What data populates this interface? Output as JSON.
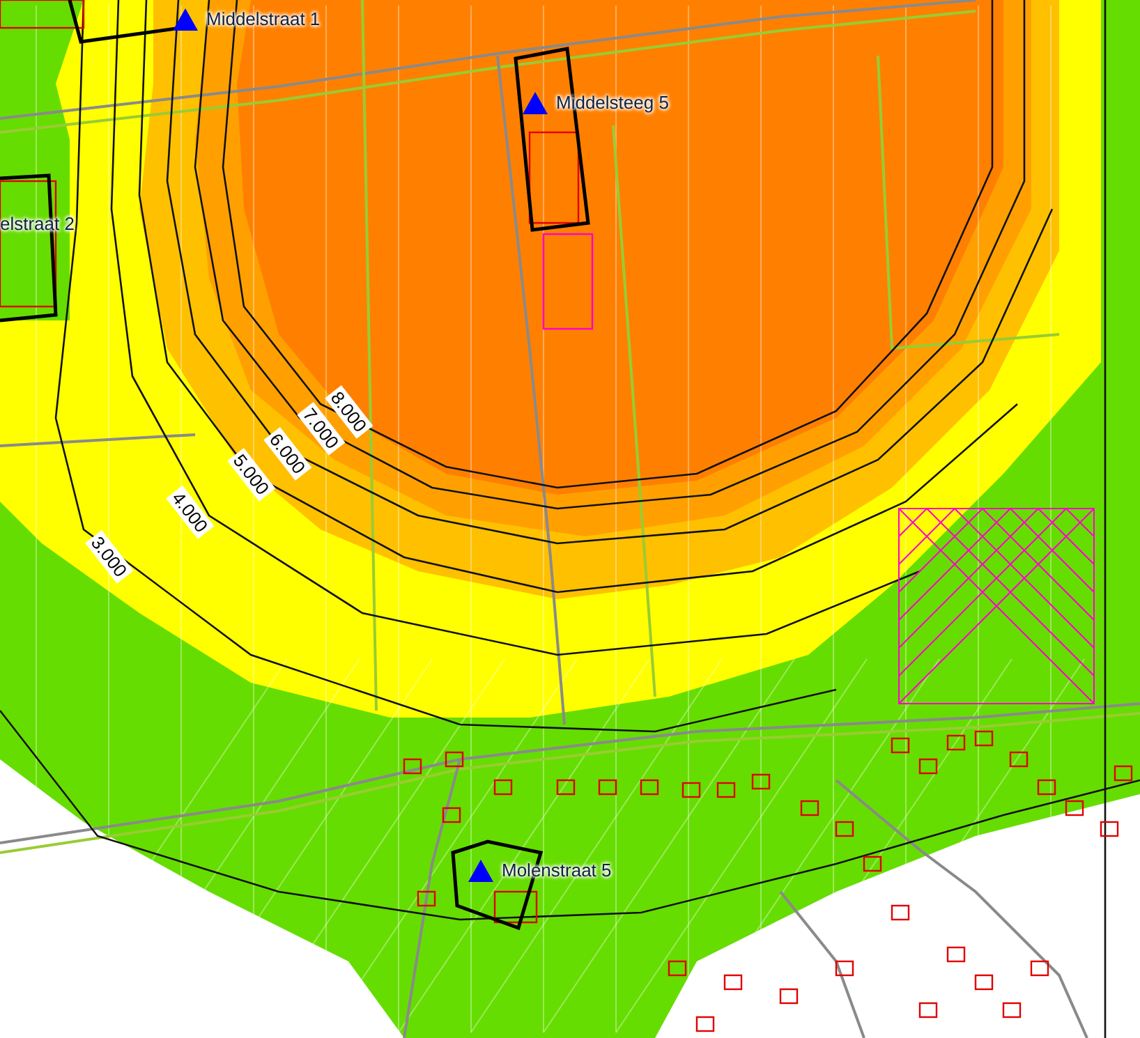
{
  "locations": [
    {
      "name": "Middelstraat 1",
      "marker": true
    },
    {
      "name": "Middelsteeg 5",
      "marker": true
    },
    {
      "name": "elstraat 2",
      "marker": false
    },
    {
      "name": "Molenstraat 5",
      "marker": true
    }
  ],
  "contours": [
    {
      "label": "8.000"
    },
    {
      "label": "7.000"
    },
    {
      "label": "6.000"
    },
    {
      "label": "5.000"
    },
    {
      "label": "4.000"
    },
    {
      "label": "3.000"
    }
  ]
}
